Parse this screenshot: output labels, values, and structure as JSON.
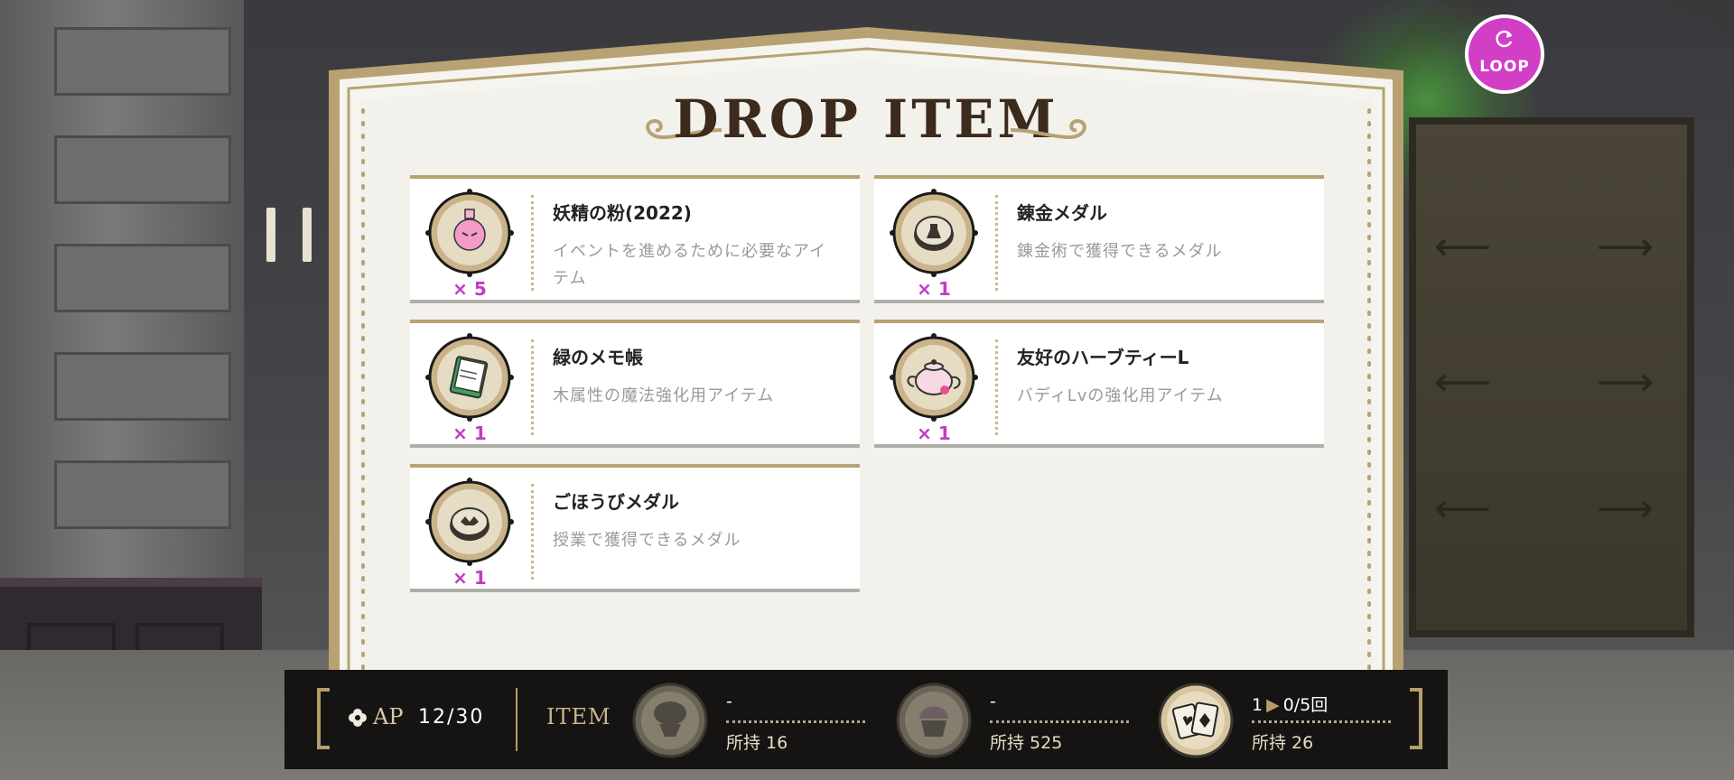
{
  "panel": {
    "title": "DROP ITEM"
  },
  "items": [
    {
      "name": "妖精の粉(2022)",
      "desc": "イベントを進めるために必要なアイテム",
      "qty": "× 5",
      "icon": "pink-fairy-potion-icon"
    },
    {
      "name": "錬金メダル",
      "desc": "錬金術で獲得できるメダル",
      "qty": "× 1",
      "icon": "alchemy-medal-icon"
    },
    {
      "name": "緑のメモ帳",
      "desc": "木属性の魔法強化用アイテム",
      "qty": "× 1",
      "icon": "green-notepad-icon"
    },
    {
      "name": "友好のハーブティーL",
      "desc": "バディLvの強化用アイテム",
      "qty": "× 1",
      "icon": "pink-teapot-icon"
    },
    {
      "name": "ごほうびメダル",
      "desc": "授業で獲得できるメダル",
      "qty": "× 1",
      "icon": "reward-medal-icon"
    }
  ],
  "loop_button": {
    "label": "LOOP",
    "color": "#d23ec6"
  },
  "bottom_bar": {
    "ap_label": "AP",
    "ap_value": "12/30",
    "item_label": "ITEM",
    "resources": [
      {
        "icon": "brain-cup-icon",
        "top": "-",
        "owned": "所持 16"
      },
      {
        "icon": "cupcake-icon",
        "top": "-",
        "owned": "所持 525"
      },
      {
        "icon": "playing-cards-icon",
        "top_left": "1",
        "top_right": "0/5回",
        "owned": "所持 26"
      }
    ]
  },
  "colors": {
    "accent_gold": "#b69e6a",
    "quantity_pink": "#c23bbf",
    "panel_bg": "#f3f1ec",
    "bar_bg": "#151412"
  }
}
